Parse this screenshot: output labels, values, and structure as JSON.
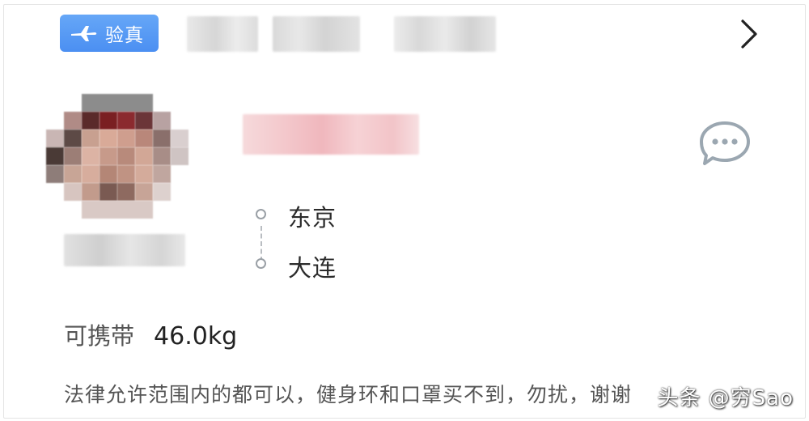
{
  "header": {
    "badge_label": "验真",
    "badge_icon": "airplane-icon",
    "colors": {
      "badge": "#4b8ff2"
    },
    "chevron_icon": "chevron-right-icon"
  },
  "profile": {
    "avatar": "pixelated-avatar",
    "chat_icon": "chat-bubble-icon"
  },
  "route": {
    "from": "东京",
    "to": "大连"
  },
  "capacity": {
    "label": "可携带",
    "weight": "46.0kg"
  },
  "note": "法律允许范围内的都可以，健身环和口罩买不到，勿扰，谢谢",
  "watermark": "头条 @穷Sao"
}
